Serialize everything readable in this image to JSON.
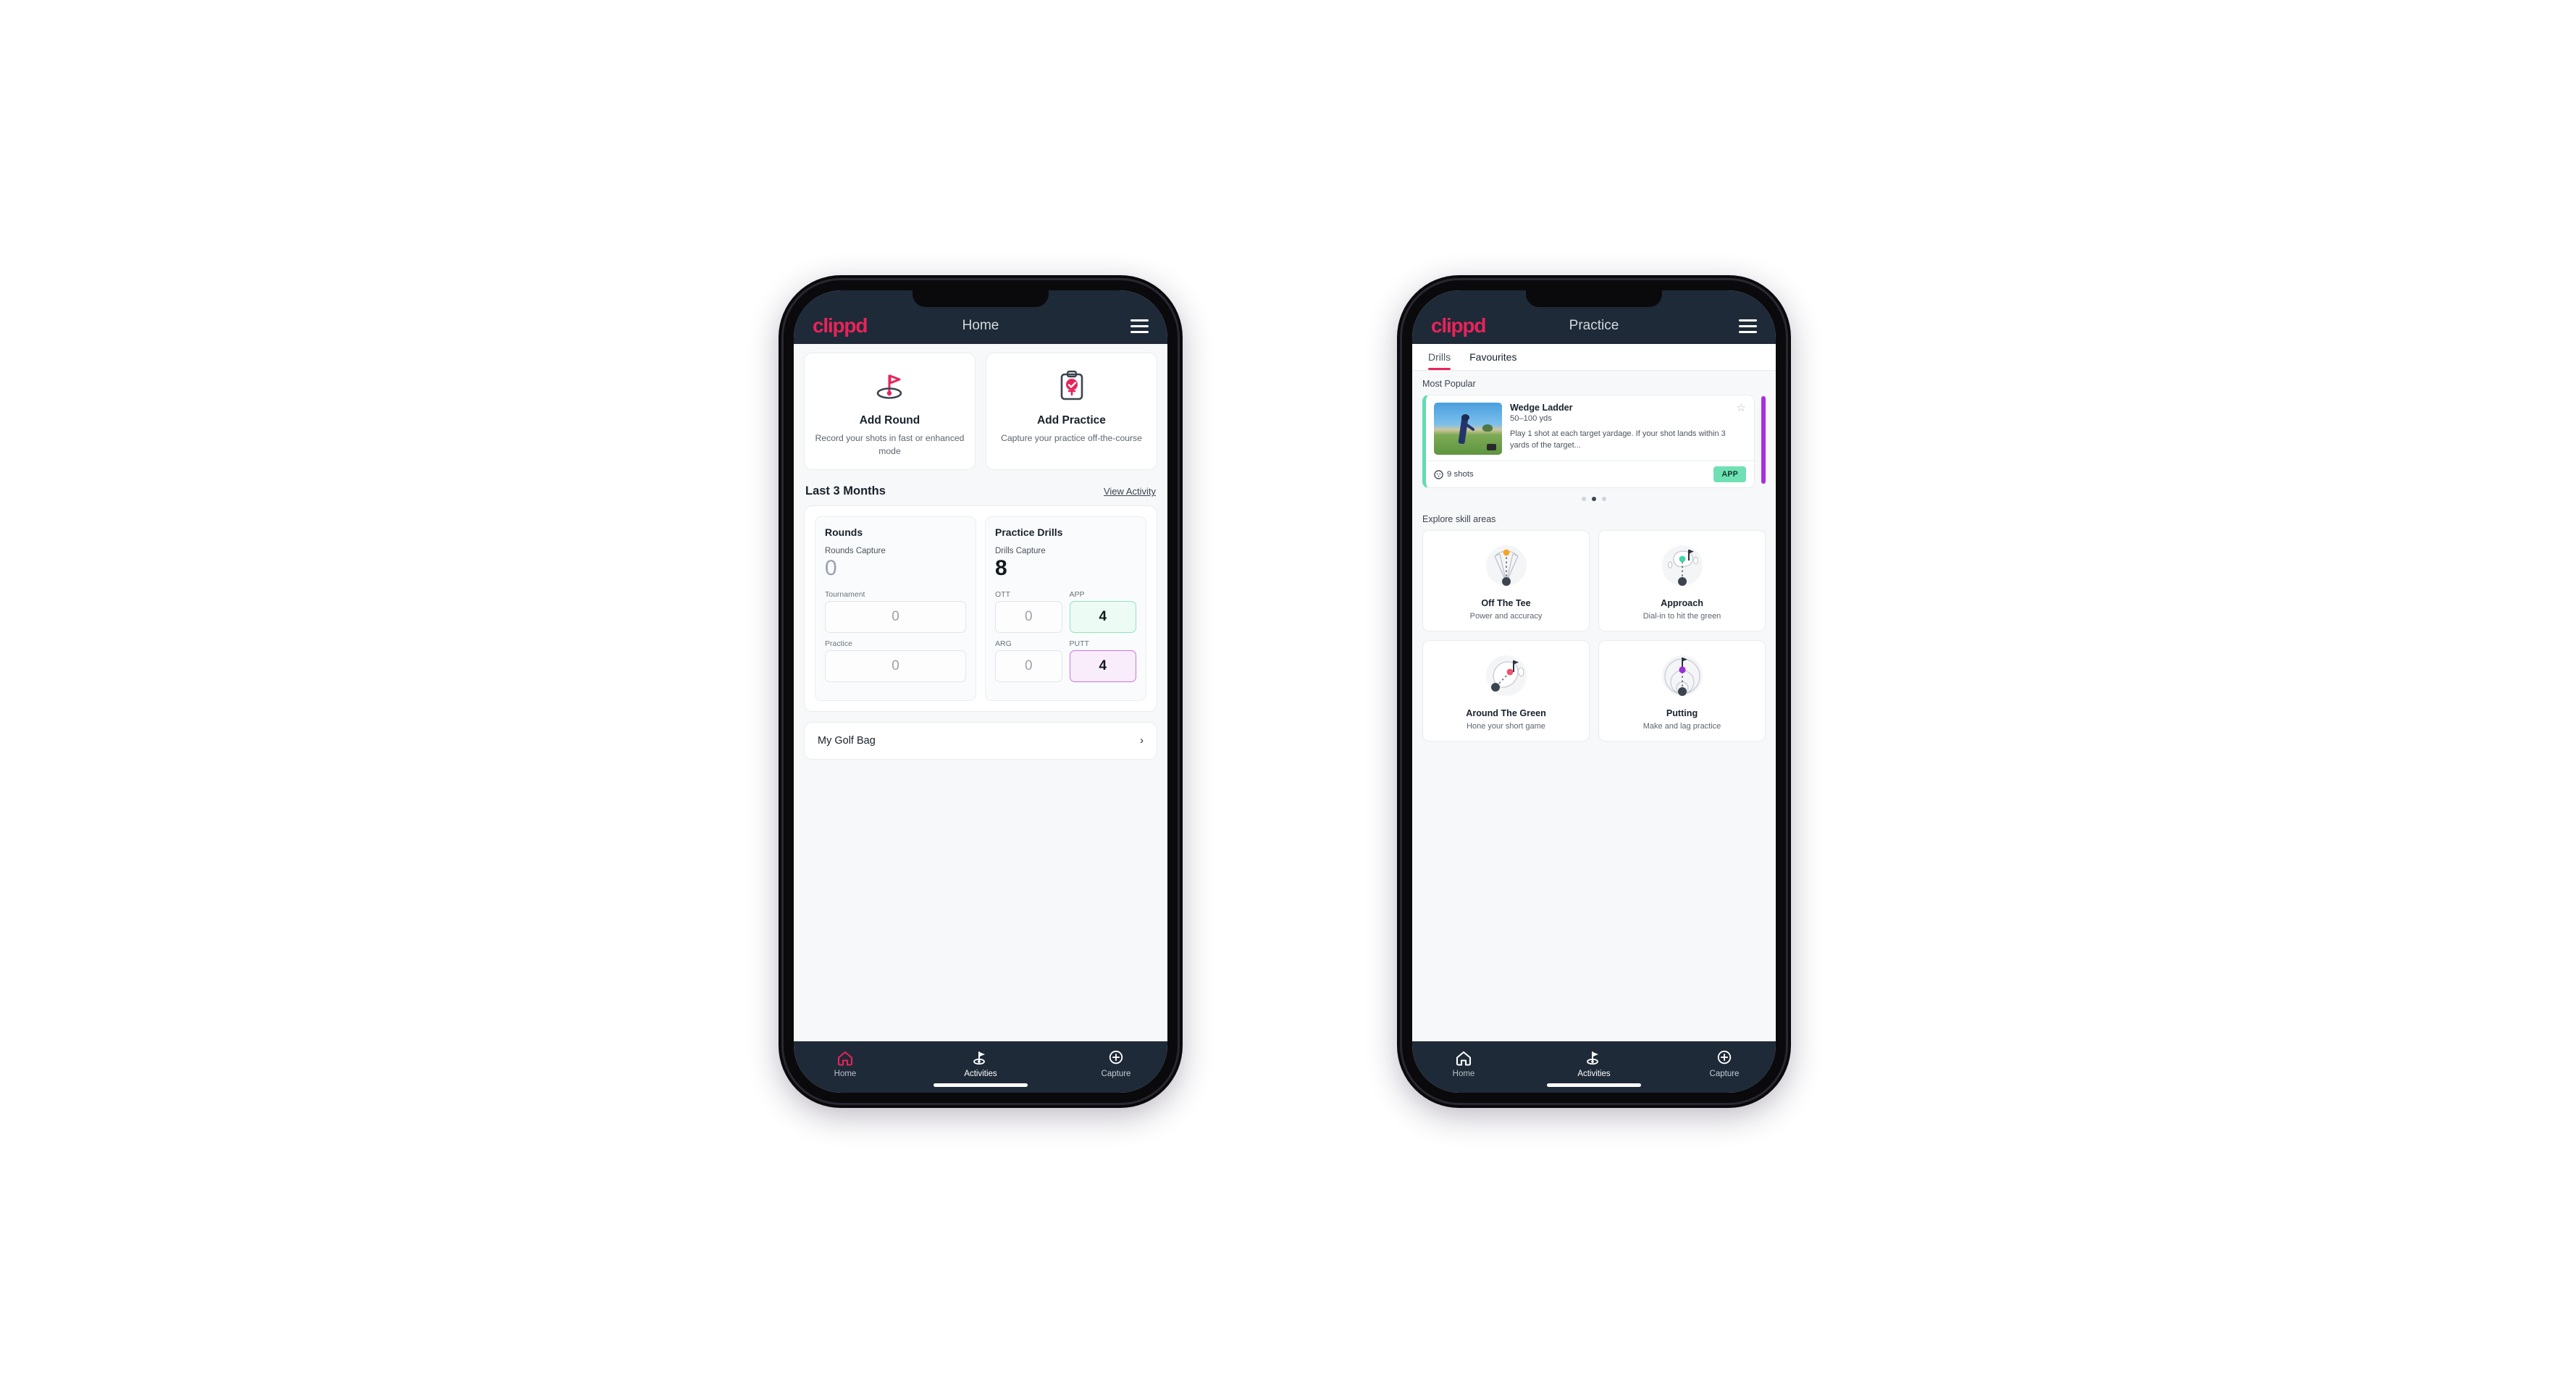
{
  "brand": {
    "logo": "clippd",
    "accent": "#e8235a",
    "bar_bg": "#1e2a38"
  },
  "phone1": {
    "appbar": {
      "title": "Home",
      "menu_icon": "hamburger-icon"
    },
    "quick_actions": [
      {
        "icon": "golf-flag-hole-icon",
        "title": "Add Round",
        "desc": "Record your shots in fast or enhanced mode"
      },
      {
        "icon": "clipboard-check-icon",
        "title": "Add Practice",
        "desc": "Capture your practice off-the-course"
      }
    ],
    "section": {
      "title": "Last 3 Months",
      "link": "View Activity"
    },
    "rounds": {
      "heading": "Rounds",
      "capture_label": "Rounds Capture",
      "capture_value": "0",
      "fields": [
        {
          "label": "Tournament",
          "value": "0",
          "state": "empty"
        },
        {
          "label": "Practice",
          "value": "0",
          "state": "empty"
        }
      ]
    },
    "drills": {
      "heading": "Practice Drills",
      "capture_label": "Drills Capture",
      "capture_value": "8",
      "fields": [
        {
          "label": "OTT",
          "value": "0",
          "state": "empty"
        },
        {
          "label": "APP",
          "value": "4",
          "state": "app"
        },
        {
          "label": "ARG",
          "value": "0",
          "state": "empty"
        },
        {
          "label": "PUTT",
          "value": "4",
          "state": "putt"
        }
      ]
    },
    "golf_bag": {
      "label": "My Golf Bag",
      "chevron": "chevron-right-icon"
    },
    "tabbar": [
      {
        "icon": "home-icon",
        "label": "Home",
        "active": false
      },
      {
        "icon": "golf-flag-icon",
        "label": "Activities",
        "active": true
      },
      {
        "icon": "plus-circle-icon",
        "label": "Capture",
        "active": false
      }
    ]
  },
  "phone2": {
    "appbar": {
      "title": "Practice",
      "menu_icon": "hamburger-icon"
    },
    "tabs": [
      {
        "label": "Drills",
        "selected": true
      },
      {
        "label": "Favourites",
        "selected": false
      }
    ],
    "most_popular_label": "Most Popular",
    "drill": {
      "title": "Wedge Ladder",
      "yardage": "50–100 yds",
      "description": "Play 1 shot at each target yardage. If your shot lands within 3 yards of the target...",
      "shots": "9 shots",
      "shots_icon": "golf-ball-icon",
      "badge": "APP",
      "badge_color": "#6fe0b5",
      "favourite_icon": "star-outline-icon",
      "accent_left": "#62dcb0",
      "peek_color": "#aa2ee0"
    },
    "carousel_dots": {
      "count": 3,
      "active_index": 1
    },
    "explore_label": "Explore skill areas",
    "skills": [
      {
        "icon": "off-the-tee-icon",
        "title": "Off The Tee",
        "desc": "Power and accuracy",
        "color": "#f5a623"
      },
      {
        "icon": "approach-icon",
        "title": "Approach",
        "desc": "Dial-in to hit the green",
        "color": "#3fd6a4"
      },
      {
        "icon": "around-the-green-icon",
        "title": "Around The Green",
        "desc": "Hone your short game",
        "color": "#f0506e"
      },
      {
        "icon": "putting-icon",
        "title": "Putting",
        "desc": "Make and lag practice",
        "color": "#9b2fd6"
      }
    ],
    "tabbar": [
      {
        "icon": "home-icon",
        "label": "Home",
        "active": false
      },
      {
        "icon": "golf-flag-icon",
        "label": "Activities",
        "active": true
      },
      {
        "icon": "plus-circle-icon",
        "label": "Capture",
        "active": false
      }
    ]
  }
}
